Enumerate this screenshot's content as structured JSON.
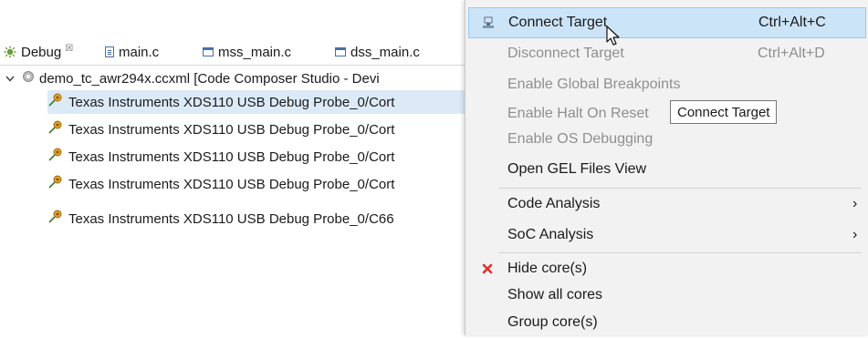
{
  "tabs": [
    {
      "label": "Debug",
      "icon": "debug-icon",
      "close": "☒"
    },
    {
      "label": "main.c",
      "icon": "c-file-icon"
    },
    {
      "label": "mss_main.c",
      "icon": "c-source-icon"
    },
    {
      "label": "dss_main.c",
      "icon": "c-source-icon"
    }
  ],
  "tree": {
    "root": {
      "label": "demo_tc_awr294x.ccxml [Code Composer Studio - Devi",
      "icon": "target-config-icon"
    },
    "children": [
      {
        "label": "Texas Instruments XDS110 USB Debug Probe_0/Cort",
        "selected": true
      },
      {
        "label": "Texas Instruments XDS110 USB Debug Probe_0/Cort",
        "selected": false
      },
      {
        "label": "Texas Instruments XDS110 USB Debug Probe_0/Cort",
        "selected": false
      },
      {
        "label": "Texas Instruments XDS110 USB Debug Probe_0/Cort",
        "selected": false
      },
      {
        "label": "Texas Instruments XDS110 USB Debug Probe_0/C66",
        "selected": false
      }
    ]
  },
  "menu": {
    "items": [
      {
        "label": "Connect Target",
        "accel": "Ctrl+Alt+C",
        "state": "highlighted",
        "icon": "connect-target-icon"
      },
      {
        "label": "Disconnect Target",
        "accel": "Ctrl+Alt+D",
        "state": "disabled"
      },
      {
        "label": "Enable Global Breakpoints",
        "state": "disabled"
      },
      {
        "label": "Enable Halt On Reset",
        "state": "disabled"
      },
      {
        "label": "Enable OS Debugging",
        "state": "disabled"
      },
      {
        "label": "Open GEL Files View",
        "state": "enabled"
      },
      {
        "label": "Code Analysis",
        "submenu": "›",
        "state": "enabled"
      },
      {
        "label": "SoC Analysis",
        "submenu": "›",
        "state": "enabled"
      },
      {
        "label": "Hide core(s)",
        "state": "enabled",
        "icon": "red-x-icon"
      },
      {
        "label": "Show all cores",
        "state": "enabled"
      },
      {
        "label": "Group core(s)",
        "state": "enabled"
      }
    ]
  },
  "tooltip": {
    "text": "Connect Target"
  },
  "colors": {
    "highlight": "#cce4f7",
    "highlight_border": "#99c9ef",
    "selection": "#dceaf8",
    "disabled_text": "#8f8f8f",
    "menu_bg": "#f2f2f2",
    "red_x": "#e0302a"
  }
}
